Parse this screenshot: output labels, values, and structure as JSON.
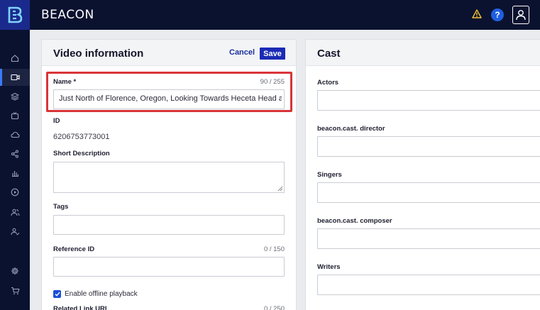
{
  "app": {
    "brand": "BEACON"
  },
  "topbar": {
    "icons": [
      "warning-icon",
      "help-icon",
      "user-icon"
    ],
    "help_label": "?"
  },
  "sidebar": {
    "items": [
      {
        "icon": "home-icon",
        "active": false
      },
      {
        "icon": "video-icon",
        "active": true
      },
      {
        "icon": "layers-icon",
        "active": false
      },
      {
        "icon": "tv-icon",
        "active": false
      },
      {
        "icon": "cloud-icon",
        "active": false
      },
      {
        "icon": "share-icon",
        "active": false
      },
      {
        "icon": "analytics-icon",
        "active": false
      },
      {
        "icon": "play-icon",
        "active": false
      },
      {
        "icon": "users-icon",
        "active": false
      },
      {
        "icon": "user-check-icon",
        "active": false
      },
      {
        "icon": "settings-icon",
        "active": false
      },
      {
        "icon": "cart-icon",
        "active": false
      }
    ]
  },
  "video_panel": {
    "title": "Video information",
    "cancel_label": "Cancel",
    "save_label": "Save",
    "name": {
      "label": "Name *",
      "counter": "90 / 255",
      "value": "Just North of Florence, Oregon, Looking Towards Heceta Head and its Lighthouse"
    },
    "id": {
      "label": "ID",
      "value": "6206753773001"
    },
    "short_description": {
      "label": "Short Description",
      "value": ""
    },
    "tags": {
      "label": "Tags",
      "value": ""
    },
    "reference_id": {
      "label": "Reference ID",
      "counter": "0 / 150",
      "value": ""
    },
    "offline_playback": {
      "label": "Enable offline playback",
      "checked": true
    },
    "related_link": {
      "label": "Related Link URL",
      "counter": "0 / 250"
    }
  },
  "cast_panel": {
    "title": "Cast",
    "fields": [
      {
        "label": "Actors"
      },
      {
        "label": "beacon.cast. director"
      },
      {
        "label": "Singers"
      },
      {
        "label": "beacon.cast. composer"
      },
      {
        "label": "Writers"
      }
    ]
  },
  "colors": {
    "accent": "#1b2bb5",
    "topbar": "#0b1230",
    "highlight": "#d8343a"
  }
}
